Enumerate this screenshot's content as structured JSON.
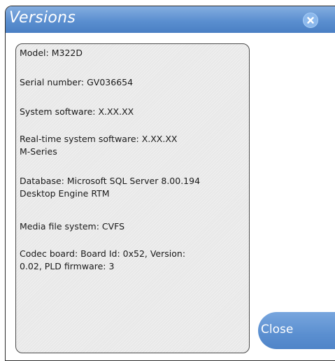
{
  "dialog": {
    "title": "Versions",
    "close_icon": "close-x-icon"
  },
  "info": {
    "model": "Model: M322D",
    "serial": "Serial number: GV036654",
    "system_software": "System software: X.XX.XX",
    "realtime_line1": "Real-time system software: X.XX.XX",
    "realtime_line2": "M-Series",
    "database_line1": "Database: Microsoft SQL Server 8.00.194",
    "database_line2": "Desktop Engine RTM",
    "media_fs": "Media file system: CVFS",
    "codec_line1": "Codec board: Board Id: 0x52, Version:",
    "codec_line2": "0.02, PLD firmware: 3"
  },
  "buttons": {
    "close_label": "Close"
  },
  "colors": {
    "titlebar": "#5b8fd0",
    "panel": "#e8e8e8",
    "button": "#5b8fd0"
  }
}
